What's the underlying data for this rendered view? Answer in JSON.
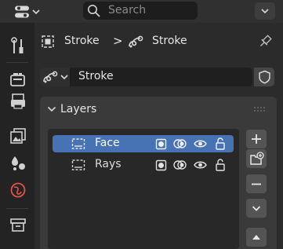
{
  "header": {
    "search_placeholder": "Search",
    "editor_type_icon": "properties-editor-icon",
    "menu_icon": "chevron-down-icon"
  },
  "tabs": [
    {
      "name": "tool-tab",
      "icon": "wrench-screwdriver-icon"
    },
    {
      "name": "render-tab",
      "icon": "camera-icon"
    },
    {
      "name": "output-tab",
      "icon": "printer-icon"
    },
    {
      "name": "view-layer-tab",
      "icon": "images-icon"
    },
    {
      "name": "scene-tab",
      "icon": "scene-icon"
    },
    {
      "name": "world-tab",
      "icon": "world-icon"
    },
    {
      "name": "collection-tab",
      "icon": "box-icon"
    }
  ],
  "breadcrumb": {
    "object_label": "Stroke",
    "separator": ">",
    "data_label": "Stroke"
  },
  "datablock": {
    "name": "Stroke"
  },
  "layers_panel": {
    "title": "Layers",
    "layers": [
      {
        "name": "Face",
        "active": true
      },
      {
        "name": "Rays",
        "active": false
      }
    ]
  },
  "colors": {
    "accent": "#4772b3",
    "world_icon": "#e2534a",
    "background": "#303030"
  }
}
